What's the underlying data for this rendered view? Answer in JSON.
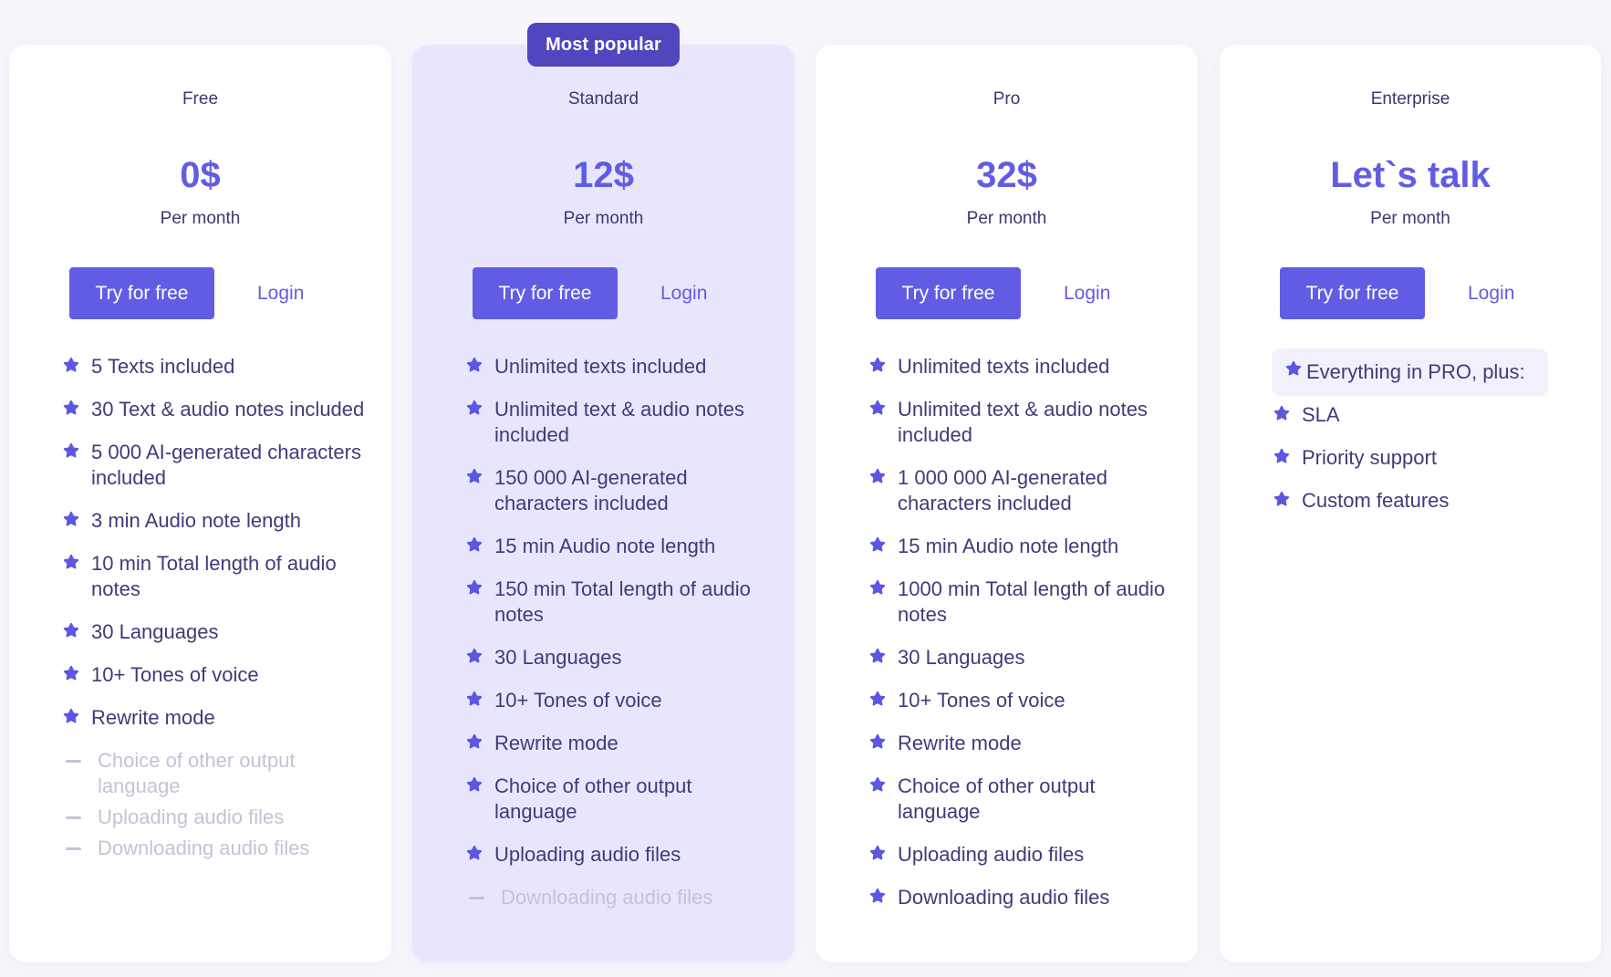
{
  "colors": {
    "accent": "#625ce4",
    "badge": "#5046be",
    "featured_card_bg": "#e8e6fc",
    "card_bg": "#ffffff",
    "page_bg": "#f6f6fb",
    "text": "#3b3773",
    "disabled_text": "#c4c3d6"
  },
  "plans": [
    {
      "name": "Free",
      "price": "0$",
      "period": "Per month",
      "primary_cta": "Try for free",
      "secondary_cta": "Login",
      "features": [
        {
          "text": "5 Texts included",
          "included": true,
          "icon": "star-icon"
        },
        {
          "text": "30 Text & audio notes included",
          "included": true,
          "icon": "star-icon"
        },
        {
          "text": "5 000 AI-generated characters included",
          "included": true,
          "icon": "star-icon"
        },
        {
          "text": "3 min Audio note length",
          "included": true,
          "icon": "star-icon"
        },
        {
          "text": "10 min Total length of audio notes",
          "included": true,
          "icon": "star-icon"
        },
        {
          "text": "30 Languages",
          "included": true,
          "icon": "star-icon"
        },
        {
          "text": "10+ Tones of voice",
          "included": true,
          "icon": "star-icon"
        },
        {
          "text": "Rewrite mode",
          "included": true,
          "icon": "star-icon"
        },
        {
          "text": "Choice of other output language",
          "included": false,
          "icon": "dash-icon"
        },
        {
          "text": "Uploading audio files",
          "included": false,
          "icon": "dash-icon"
        },
        {
          "text": "Downloading audio files",
          "included": false,
          "icon": "dash-icon"
        }
      ]
    },
    {
      "name": "Standard",
      "badge": "Most popular",
      "price": "12$",
      "period": "Per month",
      "primary_cta": "Try for free",
      "secondary_cta": "Login",
      "features": [
        {
          "text": "Unlimited texts included",
          "included": true,
          "icon": "star-icon"
        },
        {
          "text": "Unlimited text & audio notes included",
          "included": true,
          "icon": "star-icon"
        },
        {
          "text": "150 000 AI-generated characters included",
          "included": true,
          "icon": "star-icon"
        },
        {
          "text": "15 min Audio note length",
          "included": true,
          "icon": "star-icon"
        },
        {
          "text": "150 min Total length of audio notes",
          "included": true,
          "icon": "star-icon"
        },
        {
          "text": "30 Languages",
          "included": true,
          "icon": "star-icon"
        },
        {
          "text": "10+ Tones of voice",
          "included": true,
          "icon": "star-icon"
        },
        {
          "text": "Rewrite mode",
          "included": true,
          "icon": "star-icon"
        },
        {
          "text": "Choice of other output language",
          "included": true,
          "icon": "star-icon"
        },
        {
          "text": "Uploading audio files",
          "included": true,
          "icon": "star-icon"
        },
        {
          "text": "Downloading audio files",
          "included": false,
          "icon": "dash-icon"
        }
      ]
    },
    {
      "name": "Pro",
      "price": "32$",
      "period": "Per month",
      "primary_cta": "Try for free",
      "secondary_cta": "Login",
      "features": [
        {
          "text": "Unlimited texts included",
          "included": true,
          "icon": "star-icon"
        },
        {
          "text": "Unlimited text & audio notes included",
          "included": true,
          "icon": "star-icon"
        },
        {
          "text": "1 000 000 AI-generated characters included",
          "included": true,
          "icon": "star-icon"
        },
        {
          "text": "15 min Audio note length",
          "included": true,
          "icon": "star-icon"
        },
        {
          "text": "1000 min Total length of audio notes",
          "included": true,
          "icon": "star-icon"
        },
        {
          "text": "30 Languages",
          "included": true,
          "icon": "star-icon"
        },
        {
          "text": "10+ Tones of voice",
          "included": true,
          "icon": "star-icon"
        },
        {
          "text": "Rewrite mode",
          "included": true,
          "icon": "star-icon"
        },
        {
          "text": "Choice of other output language",
          "included": true,
          "icon": "star-icon"
        },
        {
          "text": "Uploading audio files",
          "included": true,
          "icon": "star-icon"
        },
        {
          "text": "Downloading audio files",
          "included": true,
          "icon": "star-icon"
        }
      ]
    },
    {
      "name": "Enterprise",
      "price": "Let`s talk",
      "period": "Per month",
      "primary_cta": "Try for free",
      "secondary_cta": "Login",
      "features": [
        {
          "text": "Everything in PRO, plus:",
          "included": true,
          "icon": "star-icon",
          "highlight": true
        },
        {
          "text": "SLA",
          "included": true,
          "icon": "star-icon"
        },
        {
          "text": "Priority support",
          "included": true,
          "icon": "star-icon"
        },
        {
          "text": "Custom features",
          "included": true,
          "icon": "star-icon"
        }
      ]
    }
  ]
}
